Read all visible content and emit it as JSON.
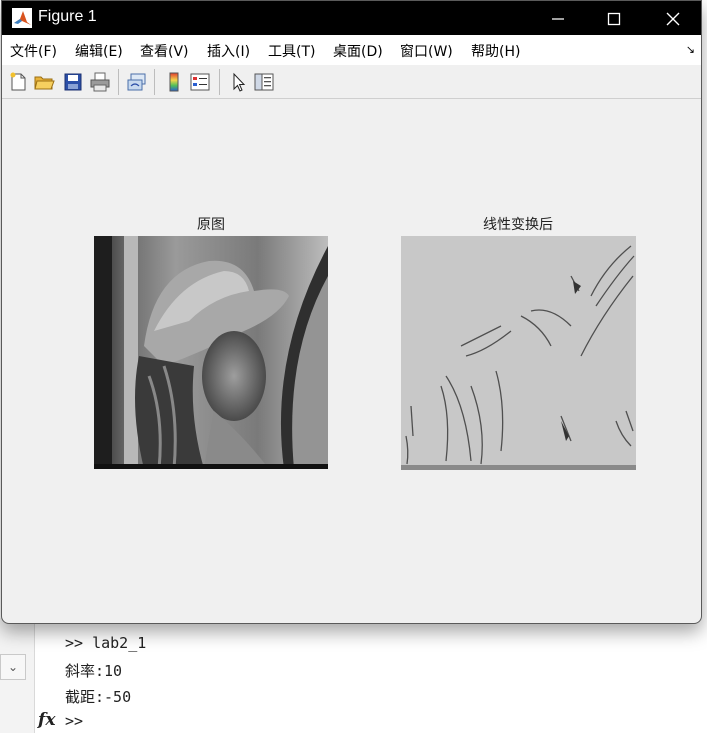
{
  "window": {
    "title": "Figure 1",
    "minimize_icon": "minimize-icon",
    "maximize_icon": "maximize-icon",
    "close_icon": "close-icon"
  },
  "menu": {
    "items": [
      "文件(F)",
      "编辑(E)",
      "查看(V)",
      "插入(I)",
      "工具(T)",
      "桌面(D)",
      "窗口(W)",
      "帮助(H)"
    ],
    "overflow_icon": "dock-arrow-icon"
  },
  "toolbar": {
    "tools": [
      "new-figure-icon",
      "open-file-icon",
      "save-icon",
      "print-icon",
      "link-plot-icon",
      "colorbar-icon",
      "legend-icon",
      "pointer-icon",
      "property-inspector-icon"
    ]
  },
  "figure": {
    "left_title": "原图",
    "right_title": "线性变换后"
  },
  "command_window": {
    "lines": [
      ">> lab2_1",
      "斜率:10",
      "截距:-50",
      ">>"
    ],
    "fx_label": "fx"
  }
}
